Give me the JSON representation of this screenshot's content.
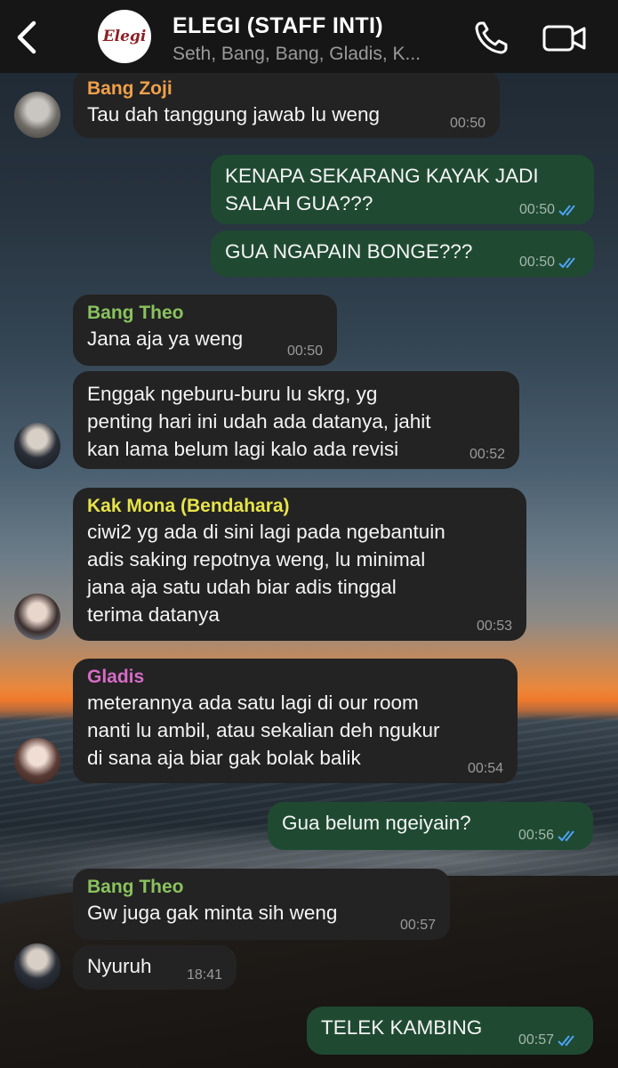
{
  "header": {
    "title": "ELEGI (STAFF INTI)",
    "subtitle": "Seth, Bang, Bang, Gladis, K...",
    "logo_text": "Elegi"
  },
  "colors": {
    "incoming_bubble": "#232323",
    "outgoing_bubble": "#1f4a31",
    "read_ticks": "#4da3f5",
    "sender_bang_zoji": "#f0a04b",
    "sender_bang_theo": "#8ac25e",
    "sender_kak_mona": "#e6e34a",
    "sender_gladis": "#d76bc6"
  },
  "icons": [
    "back-chevron-icon",
    "phone-icon",
    "video-camera-icon",
    "double-check-icon"
  ],
  "messages": [
    {
      "sender": "Bang Zoji",
      "text": "Tau dah tanggung jawab lu weng",
      "time": "00:50"
    },
    {
      "text": "KENAPA SEKARANG KAYAK JADI\nSALAH GUA???",
      "time": "00:50"
    },
    {
      "text": "GUA NGAPAIN BONGE???",
      "time": "00:50"
    },
    {
      "sender": "Bang Theo",
      "text": "Jana aja ya weng",
      "time": "00:50"
    },
    {
      "text": "Enggak ngeburu-buru lu skrg, yg\npenting hari ini udah ada datanya, jahit\nkan lama belum lagi kalo ada revisi",
      "time": "00:52"
    },
    {
      "sender": "Kak Mona (Bendahara)",
      "text": "ciwi2 yg ada di sini lagi pada ngebantuin\nadis saking repotnya weng, lu minimal\njana aja satu udah biar adis tinggal\nterima datanya",
      "time": "00:53"
    },
    {
      "sender": "Gladis",
      "text": "meterannya ada satu lagi di our room\nnanti lu ambil, atau sekalian deh ngukur\ndi sana aja biar gak bolak balik",
      "time": "00:54"
    },
    {
      "text": "Gua belum ngeiyain?",
      "time": "00:56"
    },
    {
      "sender": "Bang Theo",
      "text": "Gw juga gak minta sih weng",
      "time": "00:57"
    },
    {
      "text": "Nyuruh",
      "time": "18:41"
    },
    {
      "text": "TELEK KAMBING",
      "time": "00:57"
    }
  ]
}
